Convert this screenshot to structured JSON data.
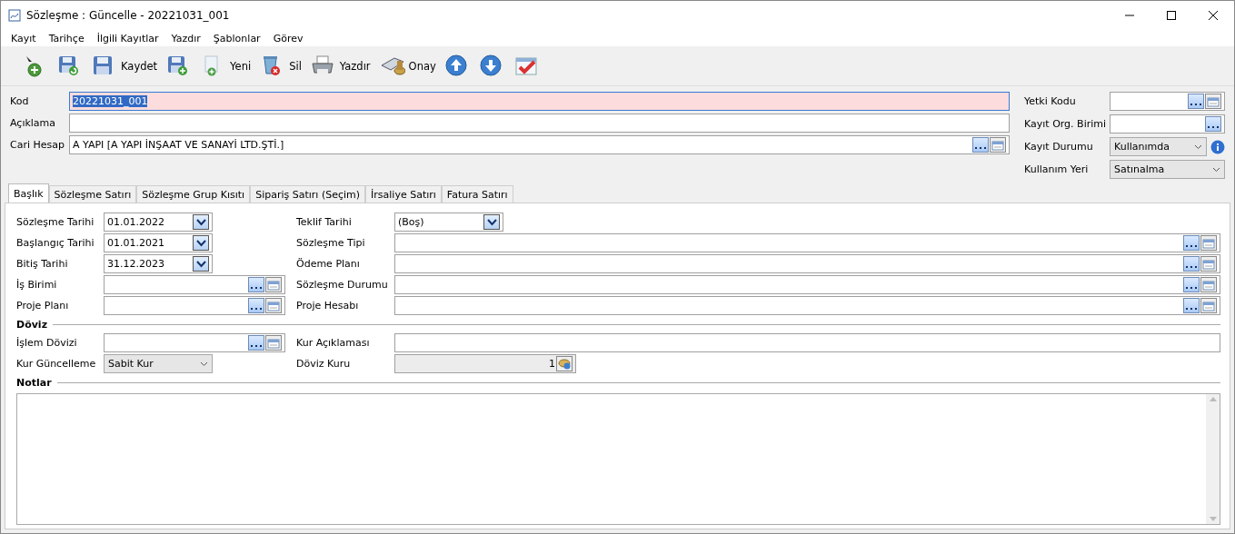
{
  "window": {
    "title": "Sözleşme : Güncelle - 20221031_001"
  },
  "menu": [
    "Kayıt",
    "Tarihçe",
    "İlgili Kayıtlar",
    "Yazdır",
    "Şablonlar",
    "Görev"
  ],
  "toolbar": [
    {
      "kind": "add"
    },
    {
      "kind": "save-reload"
    },
    {
      "kind": "save",
      "label": "Kaydet"
    },
    {
      "kind": "save-new"
    },
    {
      "kind": "new-doc",
      "label": "Yeni"
    },
    {
      "kind": "delete",
      "label": "Sil"
    },
    {
      "kind": "print",
      "label": "Yazdır"
    },
    {
      "kind": "approve",
      "label": "Onay"
    },
    {
      "kind": "up"
    },
    {
      "kind": "down"
    },
    {
      "kind": "check"
    }
  ],
  "header_left": [
    {
      "label": "Kod",
      "value": "20221031_001",
      "kind": "text",
      "required": true,
      "highlighted": true
    },
    {
      "label": "Açıklama",
      "kind": "text",
      "required": false
    },
    {
      "label": "Cari Hesap",
      "value": "A YAPI [A YAPI İNŞAAT VE SANAYİ LTD.ŞTİ.]",
      "kind": "lookup",
      "required": false,
      "highlighted": false
    }
  ],
  "header_right": [
    {
      "label": "Yetki Kodu",
      "kind": "lookup"
    },
    {
      "label": "Kayıt Org. Birimi",
      "kind": "picker"
    },
    {
      "label": "Kayıt Durumu",
      "value": "Kullanımda",
      "kind": "select-info"
    },
    {
      "label": "Kullanım Yeri",
      "value": "Satınalma",
      "kind": "select"
    }
  ],
  "tabs": [
    {
      "label": "Başlık",
      "selected": true
    },
    {
      "label": "Sözleşme Satırı",
      "selected": false
    },
    {
      "label": "Sözleşme Grup Kısıtı",
      "selected": false
    },
    {
      "label": "Sipariş Satırı (Seçim)",
      "selected": false
    },
    {
      "label": "İrsaliye Satırı",
      "selected": false
    },
    {
      "label": "Fatura Satırı",
      "selected": false
    }
  ],
  "form_rows": [
    [
      {
        "label": "Sözleşme Tarihi",
        "value": "01.01.2022",
        "kind": "date"
      },
      {
        "label": "Teklif Tarihi",
        "value": "(Boş)",
        "kind": "date"
      }
    ],
    [
      {
        "label": "Başlangıç Tarihi",
        "value": "01.01.2021",
        "kind": "date"
      },
      {
        "label": "Sözleşme Tipi",
        "kind": "lookup"
      }
    ],
    [
      {
        "label": "Bitiş Tarihi",
        "value": "31.12.2023",
        "kind": "date"
      },
      {
        "label": "Ödeme Planı",
        "kind": "lookup"
      }
    ],
    [
      {
        "label": "İş Birimi",
        "kind": "lookup"
      },
      {
        "label": "Sözleşme Durumu",
        "kind": "lookup"
      }
    ],
    [
      {
        "label": "Proje Planı",
        "kind": "lookup"
      },
      {
        "label": "Proje Hesabı",
        "kind": "lookup"
      }
    ]
  ],
  "currency": {
    "title": "Döviz",
    "rows": [
      [
        {
          "label": "İşlem Dövizi",
          "kind": "lookup"
        },
        {
          "label": "Kur Açıklaması",
          "kind": "text"
        }
      ],
      [
        {
          "label": "Kur Güncelleme",
          "value": "Sabit Kur",
          "kind": "select"
        },
        {
          "label": "Döviz Kuru",
          "value": "1",
          "kind": "calc"
        }
      ]
    ]
  },
  "notes": {
    "title": "Notlar"
  }
}
